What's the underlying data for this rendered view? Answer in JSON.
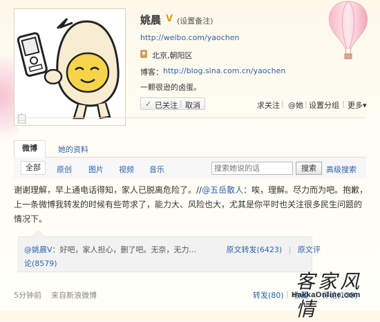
{
  "profile": {
    "name": "姚晨",
    "verified_badge": "V",
    "remark": "(设置备注)",
    "url": "http://weibo.com/yaochen",
    "location": "北京,朝阳区",
    "blog_label": "博客：",
    "blog_url": "http://blog.sina.com.cn/yaochen",
    "bio": "一颗很逊的卤蛋。"
  },
  "avatar": {
    "caption": "自戀中"
  },
  "follow": {
    "check": "✓",
    "followed": "已关注",
    "separator": "|",
    "cancel": "取消"
  },
  "actions": {
    "follow_others": "求关注",
    "at_her": "@她",
    "set_group": "设置分组",
    "more": "更多▾",
    "sep": "|"
  },
  "tabs": {
    "weibo": "微博",
    "profile": "她的资料"
  },
  "filters": {
    "all": "全部",
    "original": "原创",
    "images": "图片",
    "videos": "视频",
    "music": "音乐"
  },
  "search": {
    "placeholder": "搜索她说的话",
    "button": "搜索",
    "advanced": "高级搜索"
  },
  "post": {
    "text_before": "谢谢理解，早上通电话得知，家人已脱离危险了。//",
    "mention": "@五岳散人",
    "text_after": "：唉，理解。尽力而为吧。抱歉，上一条微博我转发的时候有些苛求了，能力大、风险也大，尤其是你平时也关注很多民生问题的情况下。",
    "quote_author": "@姚晨V",
    "quote_text": "：好吧，家人担心，删了吧。无奈，无力...",
    "quote_repost": "原文转发(6423)",
    "quote_sep": "|",
    "quote_comment_a": "原文评",
    "quote_comment_b": "论(8579)",
    "time": "5分钟前",
    "source": "来自新浪微博",
    "repost": "转发(80)",
    "favorite": "收藏",
    "comment": "评论(139)",
    "sep": "|"
  },
  "watermark": {
    "chinese": "客家风情",
    "english": "HakkaOnline.com"
  },
  "colors": {
    "link": "#2b63b0",
    "verified": "#e89a16",
    "background": "#fdf8e8"
  }
}
